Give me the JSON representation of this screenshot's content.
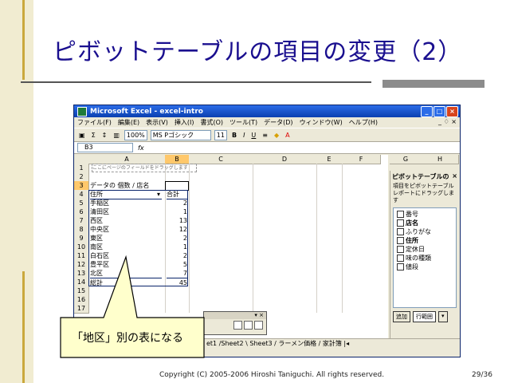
{
  "slide": {
    "title": "ピボットテーブルの項目の変更（2）",
    "footer": "Copyright (C) 2005-2006 Hiroshi Taniguchi. All rights reserved.",
    "page": "29/36",
    "callout": "「地区」別の表になる"
  },
  "excel": {
    "window_title": "Microsoft Excel - excel-intro",
    "menu": [
      "ファイル(F)",
      "編集(E)",
      "表示(V)",
      "挿入(I)",
      "書式(O)",
      "ツール(T)",
      "データ(D)",
      "ウィンドウ(W)",
      "ヘルプ(H)"
    ],
    "mdi_controls": "_ ♢ ×",
    "toolbar": {
      "zoom": "100%",
      "font": "MS Pゴシック",
      "size": "11",
      "bold": "B",
      "italic": "I",
      "underline": "U"
    },
    "name_box": "B3",
    "fx": "fx",
    "columns": [
      "A",
      "B",
      "C",
      "D",
      "E",
      "F",
      "G",
      "H"
    ],
    "rows": [
      "1",
      "2",
      "3",
      "4",
      "5",
      "6",
      "7",
      "8",
      "9",
      "10",
      "11",
      "12",
      "13",
      "14",
      "15",
      "16",
      "17"
    ],
    "page_field_hint": "ここにページのフィールドをドラッグします",
    "pivot": {
      "data_label": "データの 個数 / 店名",
      "row_header": "住所",
      "total_header": "合計",
      "rows": [
        {
          "label": "手稲区",
          "value": "2"
        },
        {
          "label": "清田区",
          "value": "1"
        },
        {
          "label": "西区",
          "value": "13"
        },
        {
          "label": "中央区",
          "value": "12"
        },
        {
          "label": "東区",
          "value": "2"
        },
        {
          "label": "南区",
          "value": "1"
        },
        {
          "label": "白石区",
          "value": "2"
        },
        {
          "label": "豊平区",
          "value": "5"
        },
        {
          "label": "北区",
          "value": "7"
        }
      ],
      "grand_total_label": "総計",
      "grand_total_value": "45"
    },
    "task_pane": {
      "title": "ピボットテーブルの",
      "close": "×",
      "description": "項目をピボットテーブル レポートにドラッグします",
      "fields": [
        {
          "name": "番号",
          "bold": false
        },
        {
          "name": "店名",
          "bold": true
        },
        {
          "name": "ふりがな",
          "bold": false
        },
        {
          "name": "住所",
          "bold": true
        },
        {
          "name": "定休日",
          "bold": false
        },
        {
          "name": "味の種類",
          "bold": false
        },
        {
          "name": "値段",
          "bold": false
        }
      ],
      "add_button": "追加",
      "target": "行範囲"
    },
    "sheet_tabs": "et1 /Sheet2 \\ Sheet3 / ラーメン価格 / 家計簿 |◂"
  }
}
